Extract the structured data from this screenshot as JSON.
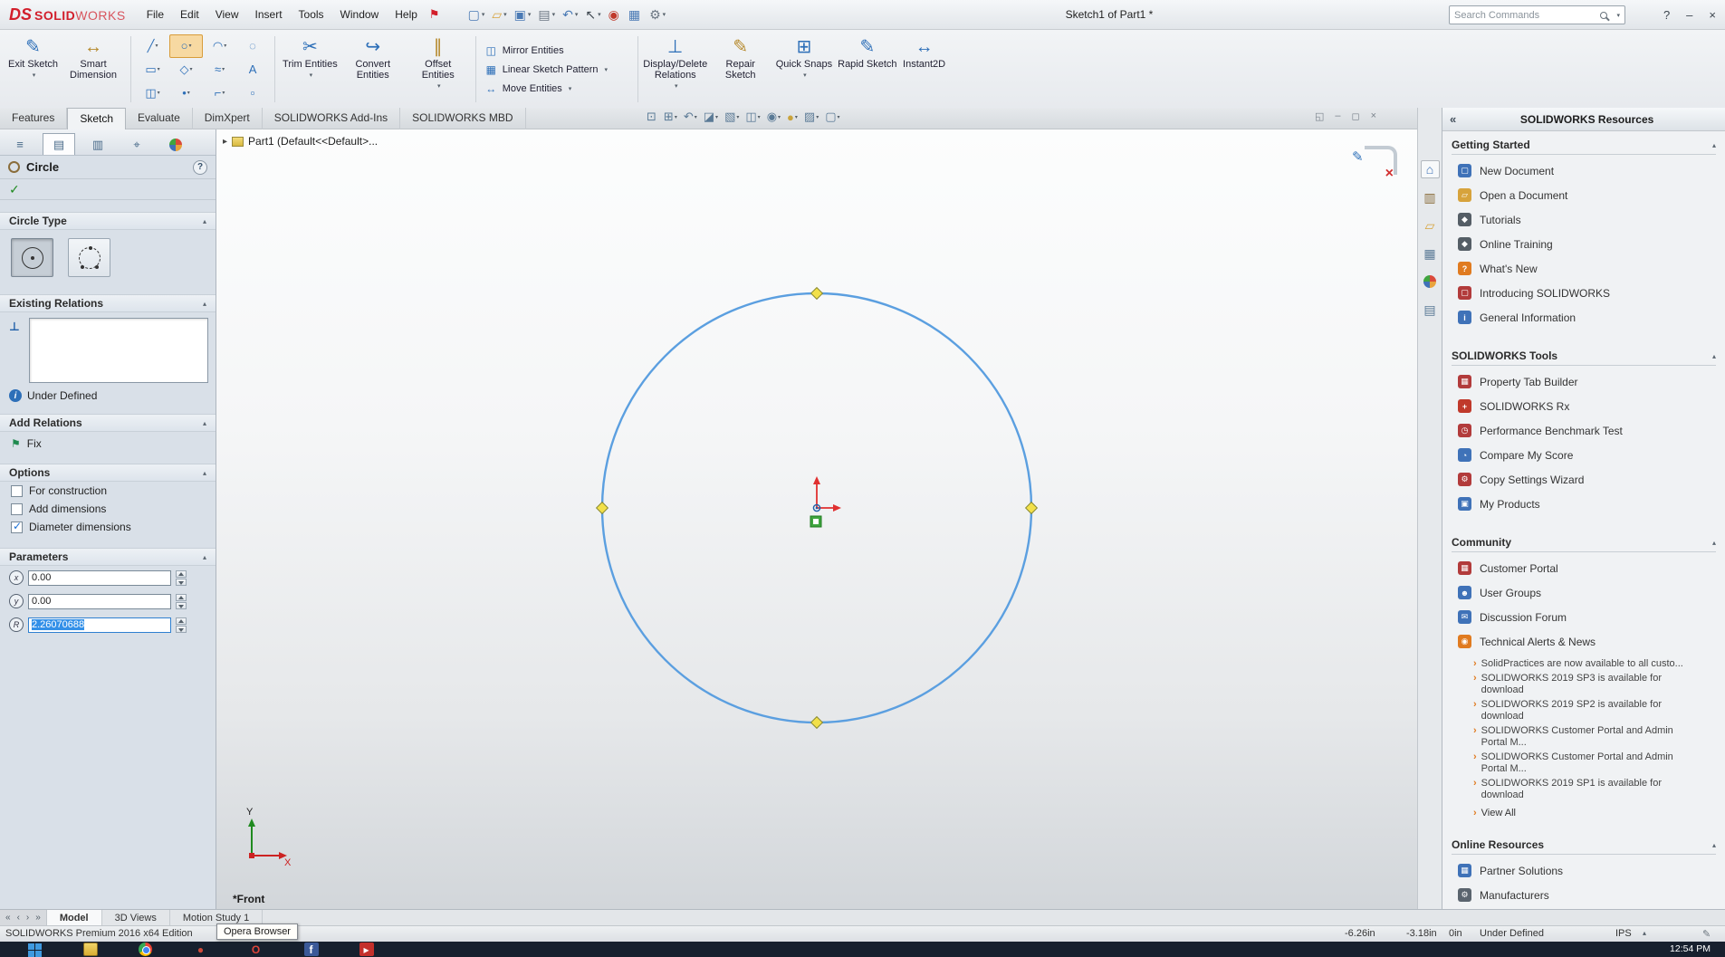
{
  "ui": {
    "collapse_glyph": "▴",
    "dropdown_glyph": "▾",
    "news_bullet": "›",
    "expander_glyph": "▸"
  },
  "titlebar": {
    "logo": {
      "mark": "DS",
      "bold": "SOLID",
      "light": "WORKS"
    },
    "menus": [
      "File",
      "Edit",
      "View",
      "Insert",
      "Tools",
      "Window",
      "Help"
    ],
    "pin_glyph": "⚑",
    "qat": [
      {
        "name": "new-document-icon",
        "glyph": "▢",
        "color": "#4a7ab5",
        "caret": "▾"
      },
      {
        "name": "open-icon",
        "glyph": "▱",
        "color": "#d7a33c",
        "caret": "▾"
      },
      {
        "name": "save-icon",
        "glyph": "▣",
        "color": "#4a7ab5",
        "caret": "▾"
      },
      {
        "name": "print-icon",
        "glyph": "▤",
        "color": "#6b7682",
        "caret": "▾"
      },
      {
        "name": "undo-icon",
        "glyph": "↶",
        "color": "#4a7ab5",
        "caret": "▾"
      },
      {
        "name": "select-icon",
        "glyph": "↖",
        "color": "#3c454e",
        "caret": "▾"
      },
      {
        "name": "rebuild-icon",
        "glyph": "◉",
        "color": "#c0392b",
        "caret": ""
      },
      {
        "name": "file-properties-icon",
        "glyph": "▦",
        "color": "#4a7ab5",
        "caret": ""
      },
      {
        "name": "options-icon",
        "glyph": "⚙",
        "color": "#6b7682",
        "caret": "▾"
      }
    ],
    "doc_title": "Sketch1 of Part1 *",
    "search_placeholder": "Search Commands",
    "controls": {
      "help": "?",
      "minimize": "–",
      "close": "×"
    }
  },
  "ribbon": {
    "big_buttons": [
      {
        "name": "exit-sketch-button",
        "glyph": "✎",
        "color": "#2d6fb8",
        "label": "Exit Sketch",
        "caret": "▾"
      },
      {
        "name": "smart-dimension-button",
        "glyph": "↔",
        "color": "#b5882a",
        "label": "Smart Dimension",
        "caret": ""
      }
    ],
    "tools": [
      {
        "name": "line-tool",
        "glyph": "╱",
        "caret": "▾"
      },
      {
        "name": "circle-tool",
        "glyph": "○",
        "caret": "▾",
        "active": true
      },
      {
        "name": "arc-tool",
        "glyph": "◠",
        "caret": "▾"
      },
      {
        "name": "ellipse-tool",
        "glyph": "◌",
        "caret": ""
      },
      {
        "name": "rectangle-tool",
        "glyph": "▭",
        "caret": "▾"
      },
      {
        "name": "polygon-tool",
        "glyph": "◇",
        "caret": "▾"
      },
      {
        "name": "spline-tool",
        "glyph": "≈",
        "caret": "▾"
      },
      {
        "name": "text-tool",
        "glyph": "A",
        "caret": ""
      },
      {
        "name": "slot-tool",
        "glyph": "◫",
        "caret": "▾"
      },
      {
        "name": "point-tool",
        "glyph": "•",
        "caret": "▾"
      },
      {
        "name": "fillet-tool",
        "glyph": "⌐",
        "caret": "▾"
      },
      {
        "name": "construction-geometry-tool",
        "glyph": "▫",
        "caret": ""
      }
    ],
    "med_buttons": [
      {
        "name": "trim-entities-button",
        "glyph": "✂",
        "color": "#2d6fb8",
        "label": "Trim Entities",
        "caret": "▾"
      },
      {
        "name": "convert-entities-button",
        "glyph": "↪",
        "color": "#2d6fb8",
        "label": "Convert Entities",
        "caret": ""
      },
      {
        "name": "offset-entities-button",
        "glyph": "∥",
        "color": "#b5882a",
        "label": "Offset Entities",
        "caret": "▾"
      }
    ],
    "stack_buttons": [
      {
        "name": "mirror-entities-button",
        "glyph": "◫",
        "label": "Mirror Entities",
        "caret": ""
      },
      {
        "name": "linear-sketch-pattern-button",
        "glyph": "▦",
        "label": "Linear Sketch Pattern",
        "caret": "▾"
      },
      {
        "name": "move-entities-button",
        "glyph": "↔",
        "label": "Move Entities",
        "caret": "▾"
      }
    ],
    "right_buttons": [
      {
        "name": "display-delete-relations-button",
        "glyph": "⊥",
        "color": "#2d6fb8",
        "label": "Display/Delete Relations",
        "caret": "▾"
      },
      {
        "name": "repair-sketch-button",
        "glyph": "✎",
        "color": "#b5882a",
        "label": "Repair Sketch",
        "caret": ""
      },
      {
        "name": "quick-snaps-button",
        "glyph": "⊞",
        "color": "#2d6fb8",
        "label": "Quick Snaps",
        "caret": "▾"
      },
      {
        "name": "rapid-sketch-button",
        "glyph": "✎",
        "color": "#2d6fb8",
        "label": "Rapid Sketch",
        "caret": ""
      },
      {
        "name": "instant2d-button",
        "glyph": "↔",
        "color": "#2d6fb8",
        "label": "Instant2D",
        "caret": ""
      }
    ],
    "tabs": [
      {
        "label": "Features"
      },
      {
        "label": "Sketch",
        "active": true
      },
      {
        "label": "Evaluate"
      },
      {
        "label": "DimXpert"
      },
      {
        "label": "SOLIDWORKS Add-Ins"
      },
      {
        "label": "SOLIDWORKS MBD"
      }
    ]
  },
  "headsup": [
    {
      "name": "zoom-to-fit-icon",
      "glyph": "⊡",
      "caret": ""
    },
    {
      "name": "zoom-to-area-icon",
      "glyph": "⊞",
      "caret": "▾"
    },
    {
      "name": "previous-view-icon",
      "glyph": "↶",
      "caret": "▾"
    },
    {
      "name": "section-view-icon",
      "glyph": "◪",
      "caret": "▾"
    },
    {
      "name": "view-orientation-icon",
      "glyph": "▧",
      "caret": "▾"
    },
    {
      "name": "display-style-icon",
      "glyph": "◫",
      "caret": "▾"
    },
    {
      "name": "hide-show-items-icon",
      "glyph": "◉",
      "caret": "▾"
    },
    {
      "name": "edit-appearance-icon",
      "glyph": "●",
      "color": "#c9a33c",
      "caret": "▾"
    },
    {
      "name": "apply-scene-icon",
      "glyph": "▨",
      "caret": "▾"
    },
    {
      "name": "view-settings-icon",
      "glyph": "▢",
      "caret": "▾"
    }
  ],
  "doc_controls": [
    {
      "name": "restore-document-button",
      "glyph": "◱"
    },
    {
      "name": "minimize-document-button",
      "glyph": "–"
    },
    {
      "name": "maximize-document-button",
      "glyph": "◻"
    },
    {
      "name": "close-document-button",
      "glyph": "×"
    }
  ],
  "pm": {
    "tabs": [
      {
        "name": "feature-manager-tab",
        "glyph": "≡"
      },
      {
        "name": "property-manager-tab",
        "glyph": "▤",
        "active": true
      },
      {
        "name": "configuration-manager-tab",
        "glyph": "▥"
      },
      {
        "name": "dimxpert-manager-tab",
        "glyph": "⌖"
      },
      {
        "name": "display-manager-tab",
        "glyph": "",
        "ball": true
      }
    ],
    "title": "Circle",
    "help_glyph": "?",
    "ok_glyph": "✓",
    "circle_type": {
      "title": "Circle Type"
    },
    "existing_relations": {
      "title": "Existing Relations",
      "icon_glyph": "⊥",
      "info_glyph": "i",
      "status": "Under Defined"
    },
    "add_relations": {
      "title": "Add Relations",
      "fix_glyph": "⚑",
      "fix_label": "Fix"
    },
    "options": {
      "title": "Options",
      "checkboxes": [
        {
          "label": "For construction",
          "checked": false
        },
        {
          "label": "Add dimensions",
          "checked": false
        },
        {
          "label": "Diameter dimensions",
          "checked": true
        }
      ]
    },
    "parameters": {
      "title": "Parameters",
      "fields": [
        {
          "name": "center-x-field",
          "icon": "x",
          "value": "0.00"
        },
        {
          "name": "center-y-field",
          "icon": "y",
          "value": "0.00"
        },
        {
          "name": "radius-field",
          "icon": "R",
          "value": "2.26070688",
          "active": true
        }
      ]
    }
  },
  "viewport": {
    "tree_label": "Part1 (Default<<Default>...",
    "front_label": "*Front",
    "axis_x": "X",
    "axis_y": "Y"
  },
  "taskpane_tabs": [
    {
      "name": "solidworks-resources-tab",
      "glyph": "⌂",
      "color": "#3a6fb5",
      "active": true
    },
    {
      "name": "design-library-tab",
      "glyph": "▥",
      "color": "#8a6d3b"
    },
    {
      "name": "file-explorer-tab",
      "glyph": "▱",
      "color": "#d7a33c"
    },
    {
      "name": "view-palette-tab",
      "glyph": "▦",
      "color": "#5a7a96"
    },
    {
      "name": "appearances-scenes-tab",
      "glyph": "",
      "ball": true
    },
    {
      "name": "custom-properties-tab",
      "glyph": "▤",
      "color": "#5a7a96"
    }
  ],
  "resources": {
    "title": "SOLIDWORKS Resources",
    "collapse_glyph": "«",
    "sections": {
      "getting_started": {
        "title": "Getting Started",
        "items": [
          {
            "label": "New Document",
            "icon": "new-document-icon",
            "glyph": "▢",
            "color": "#3f72b8"
          },
          {
            "label": "Open a Document",
            "icon": "open-document-icon",
            "glyph": "▱",
            "color": "#d7a33c"
          },
          {
            "label": "Tutorials",
            "icon": "tutorials-icon",
            "glyph": "◆",
            "color": "#555e66"
          },
          {
            "label": "Online Training",
            "icon": "online-training-icon",
            "glyph": "◆",
            "color": "#555e66"
          },
          {
            "label": "What's New",
            "icon": "whats-new-icon",
            "glyph": "?",
            "color": "#e07b20"
          },
          {
            "label": "Introducing SOLIDWORKS",
            "icon": "introducing-solidworks-icon",
            "glyph": "▢",
            "color": "#b23b3b"
          },
          {
            "label": "General Information",
            "icon": "general-information-icon",
            "glyph": "i",
            "color": "#3f72b8"
          }
        ]
      },
      "tools": {
        "title": "SOLIDWORKS Tools",
        "items": [
          {
            "label": "Property Tab Builder",
            "icon": "property-tab-builder-icon",
            "glyph": "▦",
            "color": "#b23b3b"
          },
          {
            "label": "SOLIDWORKS Rx",
            "icon": "solidworks-rx-icon",
            "glyph": "+",
            "color": "#c0392b"
          },
          {
            "label": "Performance Benchmark Test",
            "icon": "performance-benchmark-icon",
            "glyph": "◷",
            "color": "#b23b3b"
          },
          {
            "label": "Compare My Score",
            "icon": "compare-my-score-icon",
            "glyph": "◔",
            "color": "#3f72b8"
          },
          {
            "label": "Copy Settings Wizard",
            "icon": "copy-settings-wizard-icon",
            "glyph": "⚙",
            "color": "#b23b3b"
          },
          {
            "label": "My Products",
            "icon": "my-products-icon",
            "glyph": "▣",
            "color": "#3f72b8"
          }
        ]
      },
      "community": {
        "title": "Community",
        "items": [
          {
            "label": "Customer Portal",
            "icon": "customer-portal-icon",
            "glyph": "▦",
            "color": "#b23b3b"
          },
          {
            "label": "User Groups",
            "icon": "user-groups-icon",
            "glyph": "☻",
            "color": "#3f72b8"
          },
          {
            "label": "Discussion Forum",
            "icon": "discussion-forum-icon",
            "glyph": "✉",
            "color": "#3f72b8"
          },
          {
            "label": "Technical Alerts & News",
            "icon": "technical-alerts-icon",
            "glyph": "◉",
            "color": "#e07b20"
          }
        ],
        "news": [
          "SolidPractices are now available to all custo...",
          "SOLIDWORKS 2019 SP3 is available for download",
          "SOLIDWORKS 2019 SP2 is available for download",
          "SOLIDWORKS Customer Portal and Admin Portal M...",
          "SOLIDWORKS Customer Portal and Admin Portal M...",
          "SOLIDWORKS 2019 SP1 is available for download"
        ],
        "view_all": "View All"
      },
      "online": {
        "title": "Online Resources",
        "items": [
          {
            "label": "Partner Solutions",
            "icon": "partner-solutions-icon",
            "glyph": "▦",
            "color": "#3f72b8"
          },
          {
            "label": "Manufacturers",
            "icon": "manufacturers-icon",
            "glyph": "⚙",
            "color": "#5a646e"
          }
        ]
      }
    }
  },
  "bottom": {
    "nav": [
      "«",
      "‹",
      "›",
      "»"
    ],
    "tabs": [
      {
        "label": "Model",
        "active": true
      },
      {
        "label": "3D Views"
      },
      {
        "label": "Motion Study 1"
      }
    ]
  },
  "statusbar": {
    "left": "SOLIDWORKS Premium 2016 x64 Edition",
    "x": "-6.26in",
    "y": "-3.18in",
    "z": "0in",
    "state": "Under Defined",
    "units": "IPS",
    "edit_glyph": "✎"
  },
  "tooltip": "Opera Browser",
  "taskbar": {
    "time": "12:54 PM",
    "opera_glyph": "O",
    "facebook_glyph": "f",
    "play_glyph": "▸"
  }
}
